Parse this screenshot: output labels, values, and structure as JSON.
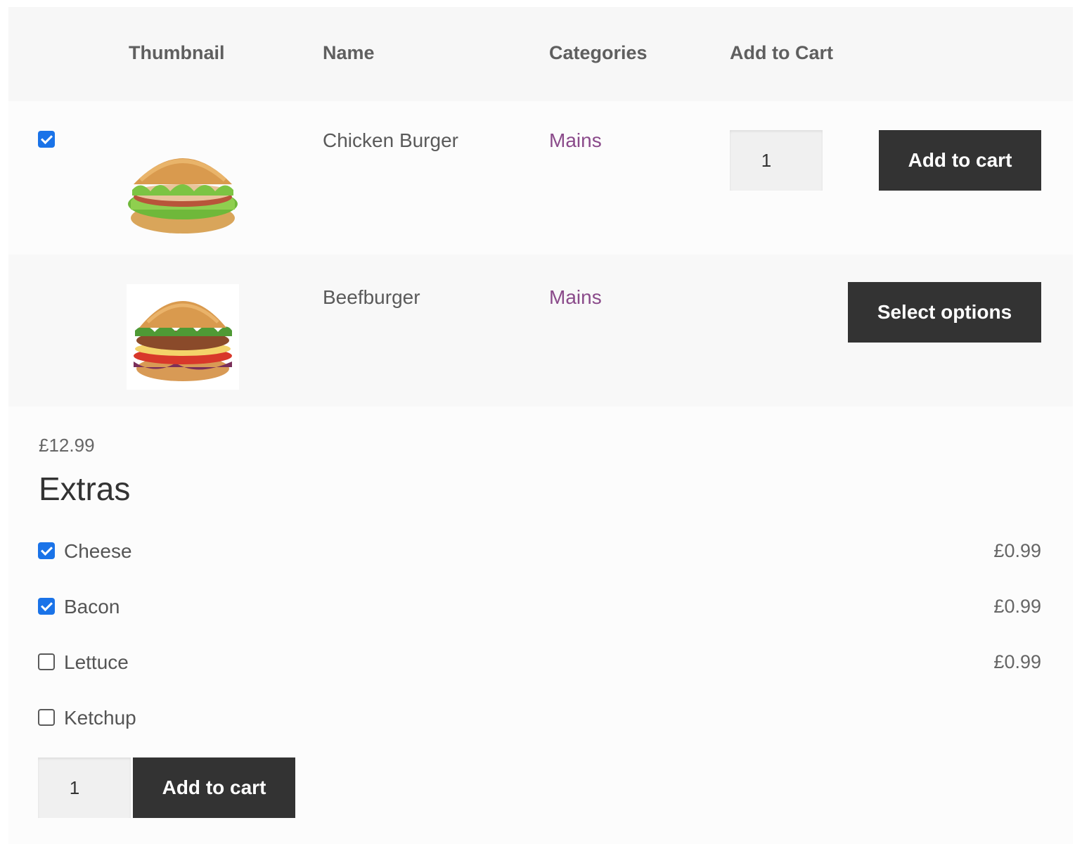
{
  "table": {
    "headers": {
      "thumbnail": "Thumbnail",
      "name": "Name",
      "categories": "Categories",
      "add_to_cart": "Add to Cart"
    },
    "rows": [
      {
        "selected": true,
        "thumbnail_icon": "chicken-burger-image",
        "name": "Chicken Burger",
        "category": "Mains",
        "quantity": "1",
        "button_label": "Add to cart"
      },
      {
        "thumbnail_icon": "beefburger-image",
        "name": "Beefburger",
        "category": "Mains",
        "button_label": "Select options"
      }
    ]
  },
  "product_options": {
    "price": "£12.99",
    "title": "Extras",
    "options": [
      {
        "label": "Cheese",
        "checked": true,
        "price": "£0.99"
      },
      {
        "label": "Bacon",
        "checked": true,
        "price": "£0.99"
      },
      {
        "label": "Lettuce",
        "checked": false,
        "price": "£0.99"
      },
      {
        "label": "Ketchup",
        "checked": false,
        "price": ""
      }
    ],
    "quantity": "1",
    "button_label": "Add to cart"
  },
  "colors": {
    "button_bg": "#333333",
    "category_link": "#8a4a8a",
    "checkbox_checked": "#1a73e8"
  }
}
